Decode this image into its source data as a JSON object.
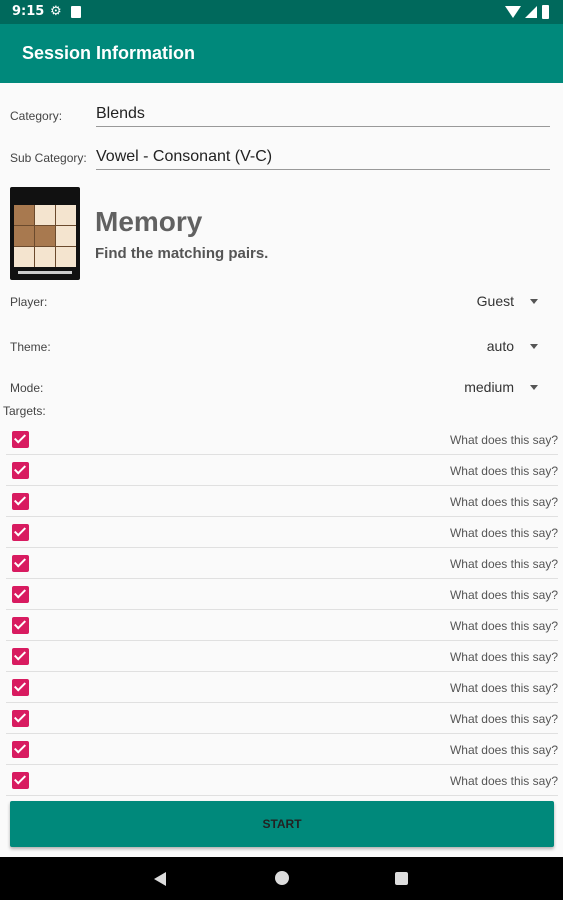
{
  "status_bar": {
    "time": "9:15"
  },
  "app_bar": {
    "title": "Session Information"
  },
  "category": {
    "label": "Category:",
    "value": "Blends"
  },
  "sub_category": {
    "label": "Sub Category:",
    "value": "Vowel - Consonant (V-C)"
  },
  "game": {
    "title": "Memory",
    "description": "Find the matching pairs."
  },
  "player": {
    "label": "Player:",
    "value": "Guest"
  },
  "theme": {
    "label": "Theme:",
    "value": "auto"
  },
  "mode": {
    "label": "Mode:",
    "value": "medium"
  },
  "targets": {
    "label": "Targets:",
    "items": [
      {
        "text": "What does this say?",
        "checked": true
      },
      {
        "text": "What does this say?",
        "checked": true
      },
      {
        "text": "What does this say?",
        "checked": true
      },
      {
        "text": "What does this say?",
        "checked": true
      },
      {
        "text": "What does this say?",
        "checked": true
      },
      {
        "text": "What does this say?",
        "checked": true
      },
      {
        "text": "What does this say?",
        "checked": true
      },
      {
        "text": "What does this say?",
        "checked": true
      },
      {
        "text": "What does this say?",
        "checked": true
      },
      {
        "text": "What does this say?",
        "checked": true
      },
      {
        "text": "What does this say?",
        "checked": true
      },
      {
        "text": "What does this say?",
        "checked": true
      }
    ]
  },
  "start_button": {
    "label": "START"
  },
  "colors": {
    "primary": "#00897b",
    "primary_dark": "#00695c",
    "accent": "#d81b60"
  }
}
